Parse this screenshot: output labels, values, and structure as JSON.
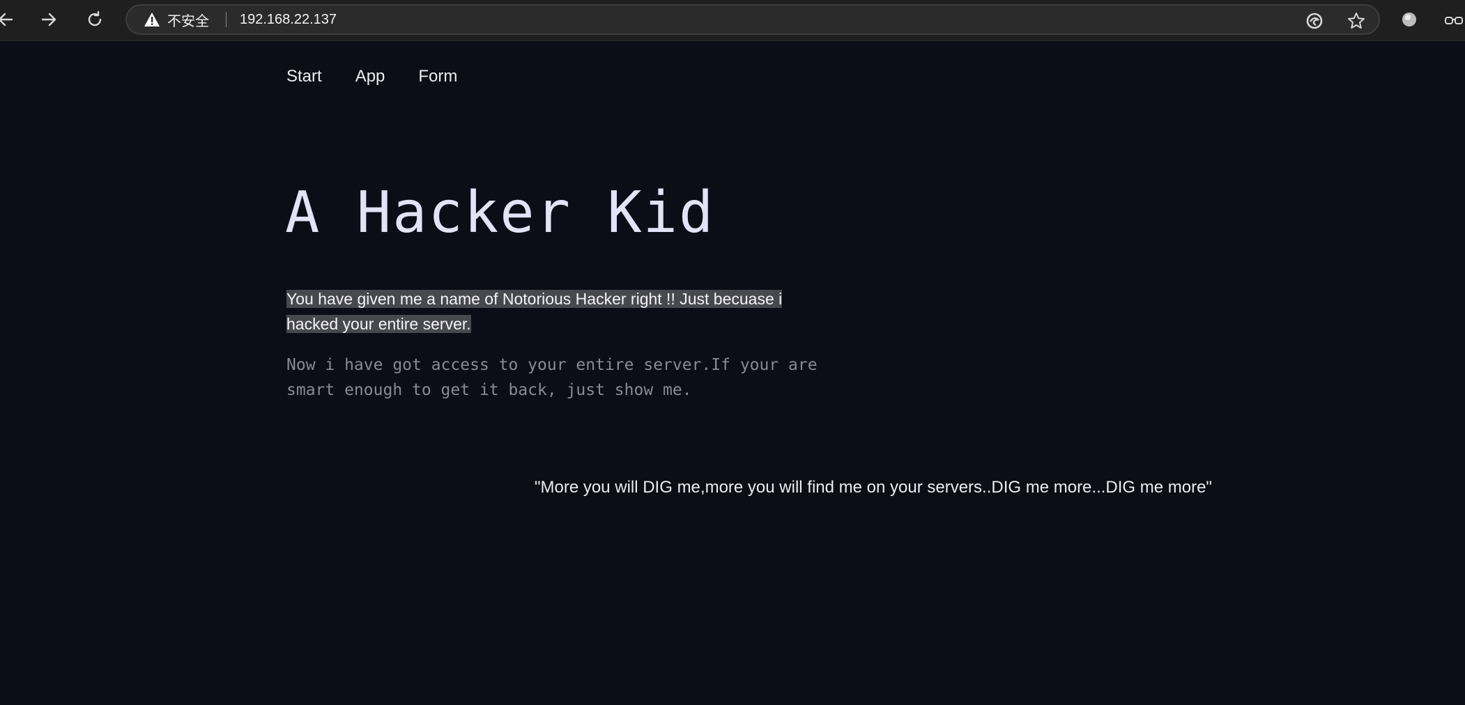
{
  "browser": {
    "security_label": "不安全",
    "url": "192.168.22.137"
  },
  "nav": {
    "items": [
      {
        "label": "Start"
      },
      {
        "label": "App"
      },
      {
        "label": "Form"
      }
    ]
  },
  "hero": {
    "title": "A Hacker Kid",
    "intro": "You have given me a name of Notorious Hacker right !! Just becuase i hacked your entire server.",
    "mono": "Now i have got access to your entire server.If your are smart enough to get it back, just show me."
  },
  "quote": "\"More you will DIG me,more you will find me on your servers..DIG me more...DIG me more\"",
  "colors": {
    "background": "#0c0d16",
    "highlight": "#48484f",
    "title": "#e4e2f6",
    "muted_mono": "#8a8a95"
  }
}
